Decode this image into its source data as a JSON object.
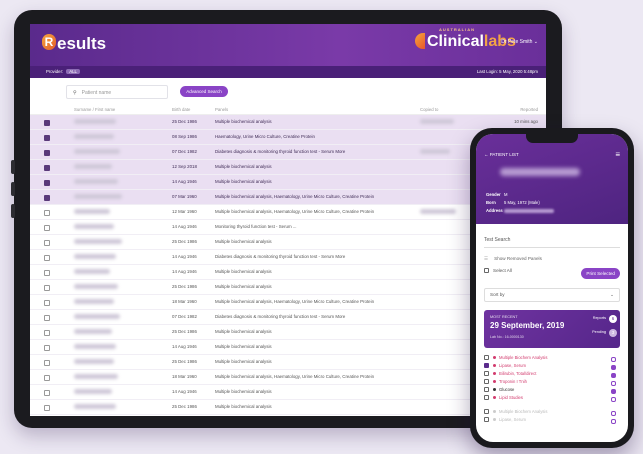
{
  "header": {
    "app_title": "esults",
    "app_initial": "R",
    "logo_top": "AUSTRALIAN",
    "logo_main": "Clinical",
    "logo_accent": "labs",
    "user_name": "Dr Pete Smith",
    "user_chevron": "⌄"
  },
  "subbar": {
    "provider_label": "Provider:",
    "provider_value": "ALL",
    "last_login": "Last Login: 5 May, 2020 5:48pm"
  },
  "search": {
    "placeholder": "Patient name",
    "advanced_label": "Advanced Search"
  },
  "table": {
    "headers": {
      "name": "Surname / First name",
      "dob": "Birth date",
      "panels": "Panels",
      "copied": "Copied to",
      "reported": "Reported"
    },
    "rows": [
      {
        "selected": true,
        "dob": "25 Dec 1986",
        "panel": "Multiple biochemical analysis",
        "reported": "10 mins ago"
      },
      {
        "selected": true,
        "dob": "08 Sep 1986",
        "panel": "Haematology, Urine Micro Culture, Creatine Protein",
        "reported": ""
      },
      {
        "selected": true,
        "dob": "07 Dec 1982",
        "panel": "Diabetes diagnosis & monitoring thyroid function test - Serum More",
        "reported": ""
      },
      {
        "selected": true,
        "dob": "12 Sep 2018",
        "panel": "Multiple biochemical analysis",
        "reported": ""
      },
      {
        "selected": true,
        "dob": "14 Aug 1946",
        "panel": "Multiple biochemical analysis",
        "reported": ""
      },
      {
        "selected": true,
        "dob": "07 Mar 1960",
        "panel": "Multiple biochemical analysis, Haematology, Urine Micro Culture, Creatine Protein",
        "reported": ""
      },
      {
        "selected": false,
        "dob": "12 Mar 1960",
        "panel": "Multiple biochemical analysis, Haematology, Urine Micro Culture, Creatine Protein",
        "reported": ""
      },
      {
        "selected": false,
        "dob": "14 Aug 1946",
        "panel": "Monitoring thyroid function test - Serum ...",
        "reported": ""
      },
      {
        "selected": false,
        "dob": "25 Dec 1986",
        "panel": "Multiple biochemical analysis",
        "reported": ""
      },
      {
        "selected": false,
        "dob": "14 Aug 1946",
        "panel": "Diabetes diagnosis & monitoring thyroid function test - Serum More",
        "reported": ""
      },
      {
        "selected": false,
        "dob": "14 Aug 1946",
        "panel": "Multiple biochemical analysis",
        "reported": ""
      },
      {
        "selected": false,
        "dob": "25 Dec 1986",
        "panel": "Multiple biochemical analysis",
        "reported": ""
      },
      {
        "selected": false,
        "dob": "18 Mar 1960",
        "panel": "Multiple biochemical analysis, Haematology, Urine Micro Culture, Creatine Protein",
        "reported": ""
      },
      {
        "selected": false,
        "dob": "07 Dec 1982",
        "panel": "Diabetes diagnosis & monitoring thyroid function test - Serum More",
        "reported": ""
      },
      {
        "selected": false,
        "dob": "25 Dec 1986",
        "panel": "Multiple biochemical analysis",
        "reported": ""
      },
      {
        "selected": false,
        "dob": "14 Aug 1946",
        "panel": "Multiple biochemical analysis",
        "reported": ""
      },
      {
        "selected": false,
        "dob": "25 Dec 1986",
        "panel": "Multiple biochemical analysis",
        "reported": ""
      },
      {
        "selected": false,
        "dob": "18 Mar 1960",
        "panel": "Multiple biochemical analysis, Haematology, Urine Micro Culture, Creatine Protein",
        "reported": ""
      },
      {
        "selected": false,
        "dob": "14 Aug 1946",
        "panel": "Multiple biochemical analysis",
        "reported": ""
      },
      {
        "selected": false,
        "dob": "25 Dec 1986",
        "panel": "Multiple biochemical analysis",
        "reported": ""
      }
    ]
  },
  "phone": {
    "title": "PATIENT LIST",
    "gender_label": "Gender",
    "gender_value": "M",
    "born_label": "Born",
    "born_value": "5 May, 1972 (Male)",
    "address_label": "Address",
    "search_label": "Test Search",
    "show_removed": "Show Removed Panels",
    "select_all": "Select All",
    "print_label": "Print Selected",
    "sort_label": "Sort by",
    "card": {
      "most_recent": "MOST RECENT",
      "date": "29 September, 2019",
      "lab_no": "Lab No.: 16-0000130",
      "reports_label": "Reports",
      "reports_count": "6",
      "pending_label": "Pending",
      "pending_count": "3"
    },
    "tests": [
      {
        "label": "Multiple Biochem Analysis",
        "style": "red",
        "checked": false,
        "filled": false
      },
      {
        "label": "Lipase, Serum",
        "style": "red",
        "checked": true,
        "filled": true
      },
      {
        "label": "Bilirubin, Total/direct",
        "style": "red",
        "checked": false,
        "filled": true
      },
      {
        "label": "Troponin I Tnih",
        "style": "red",
        "checked": false,
        "filled": false
      },
      {
        "label": "Glucose",
        "style": "dark",
        "checked": false,
        "filled": true
      },
      {
        "label": "Lipid Studies",
        "style": "red",
        "checked": false,
        "filled": false
      },
      {
        "label": "Multiple Biochem Analysis",
        "style": "faint",
        "checked": false,
        "filled": false
      },
      {
        "label": "Lipase, Serum",
        "style": "faint",
        "checked": false,
        "filled": false
      }
    ]
  }
}
